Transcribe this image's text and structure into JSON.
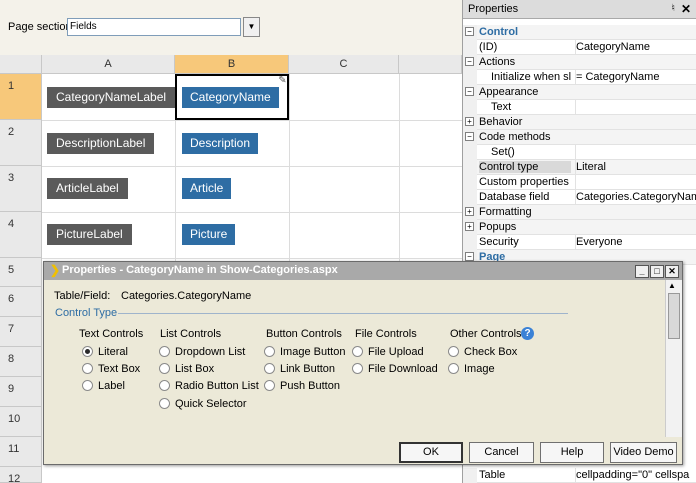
{
  "designer": {
    "section_label": "Page section:",
    "section_value": "Fields",
    "columns": [
      "A",
      "B",
      "C"
    ],
    "rows": [
      "1",
      "2",
      "3",
      "4",
      "5",
      "6",
      "7",
      "8",
      "9",
      "10",
      "11",
      "12"
    ],
    "labels": [
      "CategoryNameLabel",
      "DescriptionLabel",
      "ArticleLabel",
      "PictureLabel"
    ],
    "fields": [
      "CategoryName",
      "Description",
      "Article",
      "Picture"
    ]
  },
  "properties": {
    "title": "Properties",
    "rows": [
      {
        "name": "Control",
        "value": "",
        "type": "category"
      },
      {
        "name": "(ID)",
        "value": "CategoryName",
        "type": "prop"
      },
      {
        "name": "Actions",
        "value": "",
        "type": "category"
      },
      {
        "name": "Initialize when sl",
        "value": "= CategoryName",
        "type": "sub"
      },
      {
        "name": "Appearance",
        "value": "",
        "type": "category"
      },
      {
        "name": "Text",
        "value": "",
        "type": "sub"
      },
      {
        "name": "Behavior",
        "value": "",
        "type": "collapsed"
      },
      {
        "name": "Code methods",
        "value": "",
        "type": "category"
      },
      {
        "name": "Set()",
        "value": "",
        "type": "sub"
      },
      {
        "name": "Control type",
        "value": "Literal",
        "type": "prop-hl"
      },
      {
        "name": "Custom properties",
        "value": "",
        "type": "prop"
      },
      {
        "name": "Database field",
        "value": "Categories.CategoryNam",
        "type": "prop"
      },
      {
        "name": "Formatting",
        "value": "",
        "type": "collapsed"
      },
      {
        "name": "Popups",
        "value": "",
        "type": "collapsed"
      },
      {
        "name": "Security",
        "value": "Everyone",
        "type": "prop"
      },
      {
        "name": "Page",
        "value": "",
        "type": "category"
      }
    ],
    "bottom_row": {
      "name": "Table",
      "value": "cellpadding=\"0\" cellspa"
    }
  },
  "dialog": {
    "title": "Properties - CategoryName in Show-Categories.aspx",
    "table_field_label": "Table/Field:",
    "table_field_value": "Categories.CategoryName",
    "legend": "Control Type",
    "groups": [
      {
        "title": "Text Controls",
        "options": [
          "Literal",
          "Text Box",
          "Label"
        ]
      },
      {
        "title": "List Controls",
        "options": [
          "Dropdown List",
          "List Box",
          "Radio Button List",
          "Quick Selector"
        ]
      },
      {
        "title": "Button Controls",
        "options": [
          "Image Button",
          "Link Button",
          "Push Button"
        ]
      },
      {
        "title": "File Controls",
        "options": [
          "File Upload",
          "File Download"
        ]
      },
      {
        "title": "Other Controls",
        "options": [
          "Check Box",
          "Image"
        ]
      }
    ],
    "selected": "Literal",
    "buttons": {
      "ok": "OK",
      "cancel": "Cancel",
      "help": "Help",
      "video": "Video Demo"
    }
  },
  "colors": {
    "accent": "#2e6da4",
    "label_gray": "#5a5a5a",
    "selected_header": "#f7c87a"
  },
  "icons": {
    "help": "question-circle-icon",
    "edit": "pencil-icon",
    "close": "close-icon",
    "pin": "pin-icon"
  }
}
